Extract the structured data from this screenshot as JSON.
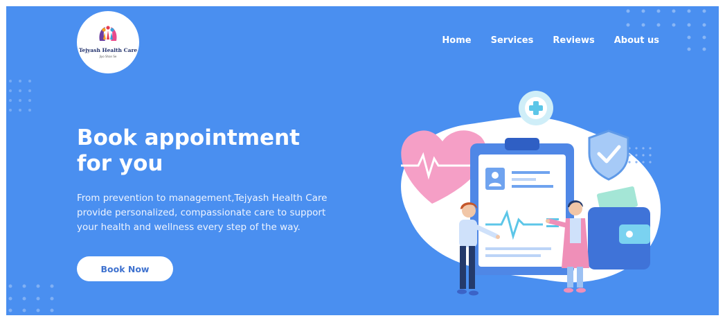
{
  "brand": {
    "name": "Tejyash Health Care",
    "tagline": "Jiyo Shan Se"
  },
  "nav": {
    "items": [
      "Home",
      "Services",
      "Reviews",
      "About us"
    ]
  },
  "hero": {
    "title_line1": "Book appointment",
    "title_line2": "for you",
    "description": "From prevention to management,Tejyash Health Care provide personalized, compassionate care to support your health and wellness every step of the way.",
    "cta_label": "Book Now"
  },
  "colors": {
    "background": "#4a8ff0",
    "cta_text": "#3f72cf",
    "heart": "#f59fc6",
    "clipboard": "#4f87e6"
  },
  "icons": [
    "medical-cross-icon",
    "heart-pulse-icon",
    "shield-check-icon",
    "profile-card-icon",
    "wallet-icon",
    "ecg-wave-icon"
  ]
}
